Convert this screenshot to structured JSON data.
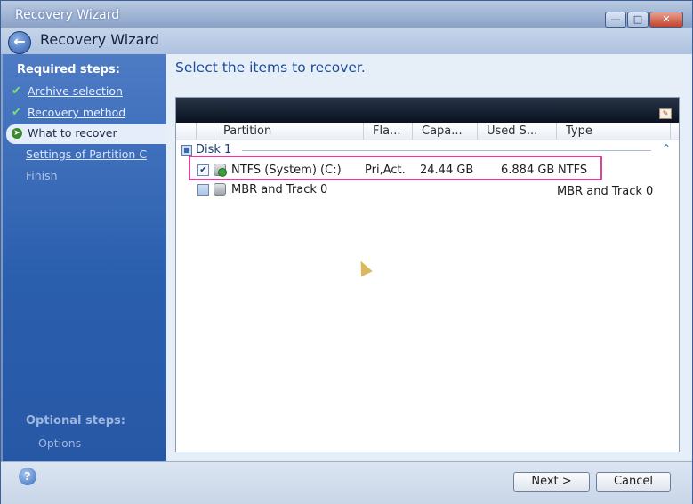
{
  "window": {
    "title": "Recovery Wizard"
  },
  "header": {
    "title": "Recovery Wizard"
  },
  "sidebar": {
    "required_heading": "Required steps:",
    "steps": [
      {
        "label": "Archive selection",
        "state": "done"
      },
      {
        "label": "Recovery method",
        "state": "done"
      },
      {
        "label": "What to recover",
        "state": "current"
      },
      {
        "label": "Settings of Partition C",
        "state": "pending"
      },
      {
        "label": "Finish",
        "state": "disabled"
      }
    ],
    "optional_heading": "Optional steps:",
    "optional_items": [
      {
        "label": "Options"
      }
    ]
  },
  "main": {
    "heading": "Select the items to recover.",
    "columns": [
      "Partition",
      "Fla...",
      "Capa...",
      "Used S...",
      "Type"
    ],
    "disk": {
      "label": "Disk 1"
    },
    "rows": [
      {
        "name": "NTFS (System) (C:)",
        "flags": "Pri,Act.",
        "capacity": "24.44 GB",
        "used": "6.884 GB",
        "type": "NTFS",
        "checked": true
      },
      {
        "name": "MBR and Track 0",
        "flags": "",
        "capacity": "",
        "used": "",
        "type": "MBR and Track 0",
        "checked": false
      }
    ]
  },
  "footer": {
    "next_label": "Next >",
    "cancel_label": "Cancel"
  },
  "colors": {
    "accent": "#1e4c9a",
    "highlight": "#e23f9a",
    "sidebar": "#2a5fae"
  }
}
